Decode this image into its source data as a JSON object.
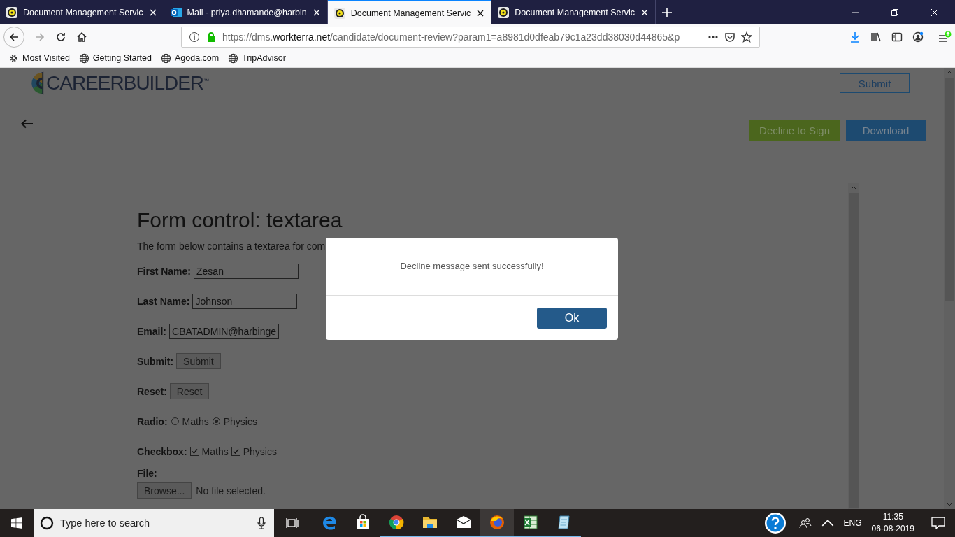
{
  "tabs": [
    {
      "title": "Document Management Servic",
      "kind": "site",
      "selected": false
    },
    {
      "title": "Mail - priya.dhamande@harbin",
      "kind": "mail",
      "selected": false
    },
    {
      "title": "Document Management Servic",
      "kind": "site",
      "selected": true
    },
    {
      "title": "Document Management Servic",
      "kind": "site",
      "selected": false
    }
  ],
  "address": {
    "prefix": "https://dms.",
    "domain": "workterra.net",
    "path": "/candidate/document-review?param1=a8981d0dfeab79c1a23dd38030d44865&p"
  },
  "bookmarks": [
    {
      "label": "Most Visited",
      "kind": "gear"
    },
    {
      "label": "Getting Started",
      "kind": "globe"
    },
    {
      "label": "Agoda.com",
      "kind": "globe"
    },
    {
      "label": "TripAdvisor",
      "kind": "globe"
    }
  ],
  "logo": "**CAREER**BUILDER",
  "logo_mark": "™",
  "header_button": "Submit",
  "actions": [
    {
      "label": "Decline to Sign",
      "kind": "decline"
    },
    {
      "label": "Download",
      "kind": "download"
    }
  ],
  "form": {
    "title": "Form control: textarea",
    "intro": "The form below contains a textarea for com",
    "rows": [
      {
        "kind": "text",
        "label": "First Name:",
        "value": "Zesan"
      },
      {
        "kind": "text",
        "label": "Last Name:",
        "value": "Johnson"
      },
      {
        "kind": "text",
        "label": "Email:",
        "value": "CBATADMIN@harbinge"
      },
      {
        "kind": "button",
        "label": "Submit:",
        "value": "Submit"
      },
      {
        "kind": "button",
        "label": "Reset:",
        "value": "Reset"
      },
      {
        "kind": "radio",
        "label": "Radio:",
        "options": [
          {
            "label": "Maths",
            "selected": false
          },
          {
            "label": "Physics",
            "selected": true
          }
        ]
      },
      {
        "kind": "checkbox",
        "label": "Checkbox:",
        "options": [
          {
            "label": "Maths",
            "checked": true
          },
          {
            "label": "Physics",
            "checked": true
          }
        ]
      },
      {
        "kind": "file",
        "label": "File:",
        "button": "Browse...",
        "status": "No file selected."
      }
    ]
  },
  "dialog": {
    "message": "Decline message sent successfully!",
    "button": "Ok"
  },
  "taskbar": {
    "search_placeholder": "Type here to search",
    "apps": [
      {
        "kind": "edge",
        "running": false,
        "selected": false
      },
      {
        "kind": "store",
        "running": false,
        "selected": false
      },
      {
        "kind": "chrome",
        "running": true,
        "selected": false
      },
      {
        "kind": "folder",
        "running": true,
        "selected": false
      },
      {
        "kind": "mail",
        "running": true,
        "selected": false
      },
      {
        "kind": "firefox",
        "running": true,
        "selected": true
      },
      {
        "kind": "excel",
        "running": true,
        "selected": false
      },
      {
        "kind": "notepad",
        "running": true,
        "selected": false
      }
    ],
    "language": "ENG",
    "time": "11:35",
    "date": "06-08-2019"
  }
}
